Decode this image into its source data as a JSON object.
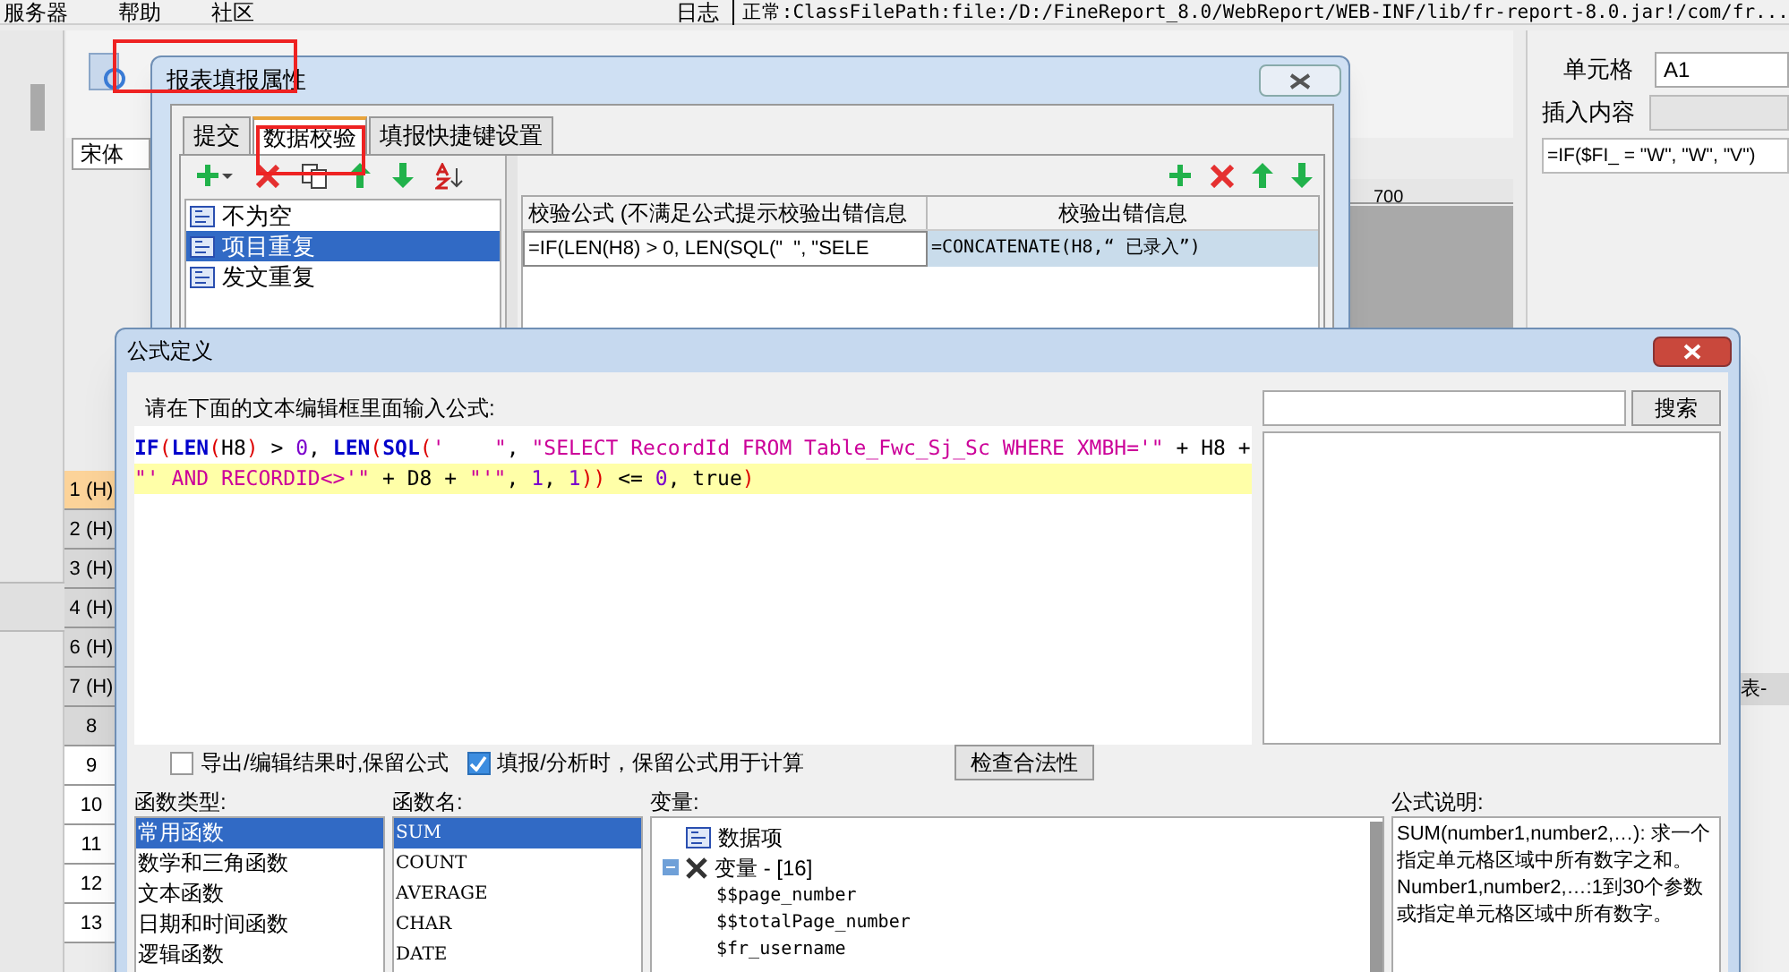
{
  "menu_bar": {
    "items": [
      "服务器",
      "帮助",
      "社区"
    ],
    "log": "日志",
    "status": "正常:ClassFilePath:file:/D:/FineReport_8.0/WebReport/WEB-INF/lib/fr-report-8.0.jar!/com/fr..."
  },
  "toolbar": {
    "font": "宋体",
    "ruler_mark": "700"
  },
  "row_headers": [
    {
      "label": "1 (H)",
      "selected": true
    },
    {
      "label": "2 (H)",
      "selected": false
    },
    {
      "label": "3 (H)",
      "selected": false
    },
    {
      "label": "4 (H)",
      "selected": false
    },
    {
      "label": "6 (H)",
      "selected": false
    },
    {
      "label": "7 (H)",
      "selected": false
    },
    {
      "label": "8",
      "selected": false
    },
    {
      "label": "9",
      "selected": false
    },
    {
      "label": "10",
      "selected": false
    },
    {
      "label": "11",
      "selected": false
    },
    {
      "label": "12",
      "selected": false
    },
    {
      "label": "13",
      "selected": false
    }
  ],
  "right_panel": {
    "cell_label": "单元格",
    "cell_value": "A1",
    "insert_label": "插入内容",
    "formula": "=IF($FI_ = \"W\", \"W\", \"V\")",
    "side_tab": "表-"
  },
  "report_dialog": {
    "title": "报表填报属性",
    "tabs": [
      {
        "label": "提交",
        "selected": false
      },
      {
        "label": "数据校验",
        "selected": true
      },
      {
        "label": "填报快捷键设置",
        "selected": false
      }
    ],
    "rules": [
      {
        "label": "不为空",
        "selected": false
      },
      {
        "label": "项目重复",
        "selected": true
      },
      {
        "label": "发文重复",
        "selected": false
      }
    ],
    "columns": [
      "校验公式 (不满足公式提示校验出错信息",
      "校验出错信息"
    ],
    "rows": [
      [
        "=IF(LEN(H8) > 0, LEN(SQL(\"  \", \"SELE",
        "=CONCATENATE(H8,“ 已录入”)"
      ]
    ]
  },
  "formula_dialog": {
    "title": "公式定义",
    "prompt": "请在下面的文本编辑框里面输入公式:",
    "lines": [
      [
        {
          "kind": "func",
          "text": "IF"
        },
        {
          "kind": "paren",
          "text": "("
        },
        {
          "kind": "func",
          "text": "LEN"
        },
        {
          "kind": "paren",
          "text": "("
        },
        {
          "kind": "plain",
          "text": "H8"
        },
        {
          "kind": "paren",
          "text": ")"
        },
        {
          "kind": "plain",
          "text": " > "
        },
        {
          "kind": "number",
          "text": "0"
        },
        {
          "kind": "plain",
          "text": ", "
        },
        {
          "kind": "func",
          "text": "LEN"
        },
        {
          "kind": "paren",
          "text": "("
        },
        {
          "kind": "func",
          "text": "SQL"
        },
        {
          "kind": "paren",
          "text": "("
        },
        {
          "kind": "string",
          "text": "'    \""
        },
        {
          "kind": "plain",
          "text": ", "
        },
        {
          "kind": "string",
          "text": "\"SELECT RecordId FROM Table_Fwc_Sj_Sc WHERE XMBH='\""
        },
        {
          "kind": "plain",
          "text": " + H8 +"
        }
      ],
      [
        {
          "kind": "string",
          "text": "\"' AND RECORDID<>'\""
        },
        {
          "kind": "plain",
          "text": " + D8 + "
        },
        {
          "kind": "string",
          "text": "\"'\""
        },
        {
          "kind": "plain",
          "text": ", "
        },
        {
          "kind": "number",
          "text": "1"
        },
        {
          "kind": "plain",
          "text": ", "
        },
        {
          "kind": "number",
          "text": "1"
        },
        {
          "kind": "paren",
          "text": "))"
        },
        {
          "kind": "plain",
          "text": " <= "
        },
        {
          "kind": "number",
          "text": "0"
        },
        {
          "kind": "plain",
          "text": ", true"
        },
        {
          "kind": "paren",
          "text": ")"
        }
      ]
    ],
    "search_button": "搜索",
    "options": [
      {
        "label": "导出/编辑结果时,保留公式",
        "checked": false
      },
      {
        "label": "填报/分析时，保留公式用于计算",
        "checked": true
      }
    ],
    "check_button": "检查合法性",
    "function_types": {
      "label": "函数类型:",
      "items": [
        {
          "label": "常用函数",
          "selected": true
        },
        {
          "label": "数学和三角函数",
          "selected": false
        },
        {
          "label": "文本函数",
          "selected": false
        },
        {
          "label": "日期和时间函数",
          "selected": false
        },
        {
          "label": "逻辑函数",
          "selected": false
        }
      ]
    },
    "function_names": {
      "label": "函数名:",
      "items": [
        {
          "label": "SUM",
          "selected": true
        },
        {
          "label": "COUNT",
          "selected": false
        },
        {
          "label": "AVERAGE",
          "selected": false
        },
        {
          "label": "CHAR",
          "selected": false
        },
        {
          "label": "DATE",
          "selected": false
        }
      ]
    },
    "variables": {
      "label": "变量:",
      "tree": [
        {
          "label": "数据项",
          "kind": "data"
        },
        {
          "label": "变量 - [16]",
          "kind": "vars",
          "expanded": true,
          "children": [
            {
              "label": "$$page_number"
            },
            {
              "label": "$$totalPage_number"
            },
            {
              "label": "$fr_username"
            }
          ]
        }
      ]
    },
    "description": {
      "label": "公式说明:",
      "text": "SUM(number1,number2,…): 求一个指定单元格区域中所有数字之和。",
      "text2": "Number1,number2,…:1到30个参数或指定单元格区域中所有数字。"
    }
  }
}
